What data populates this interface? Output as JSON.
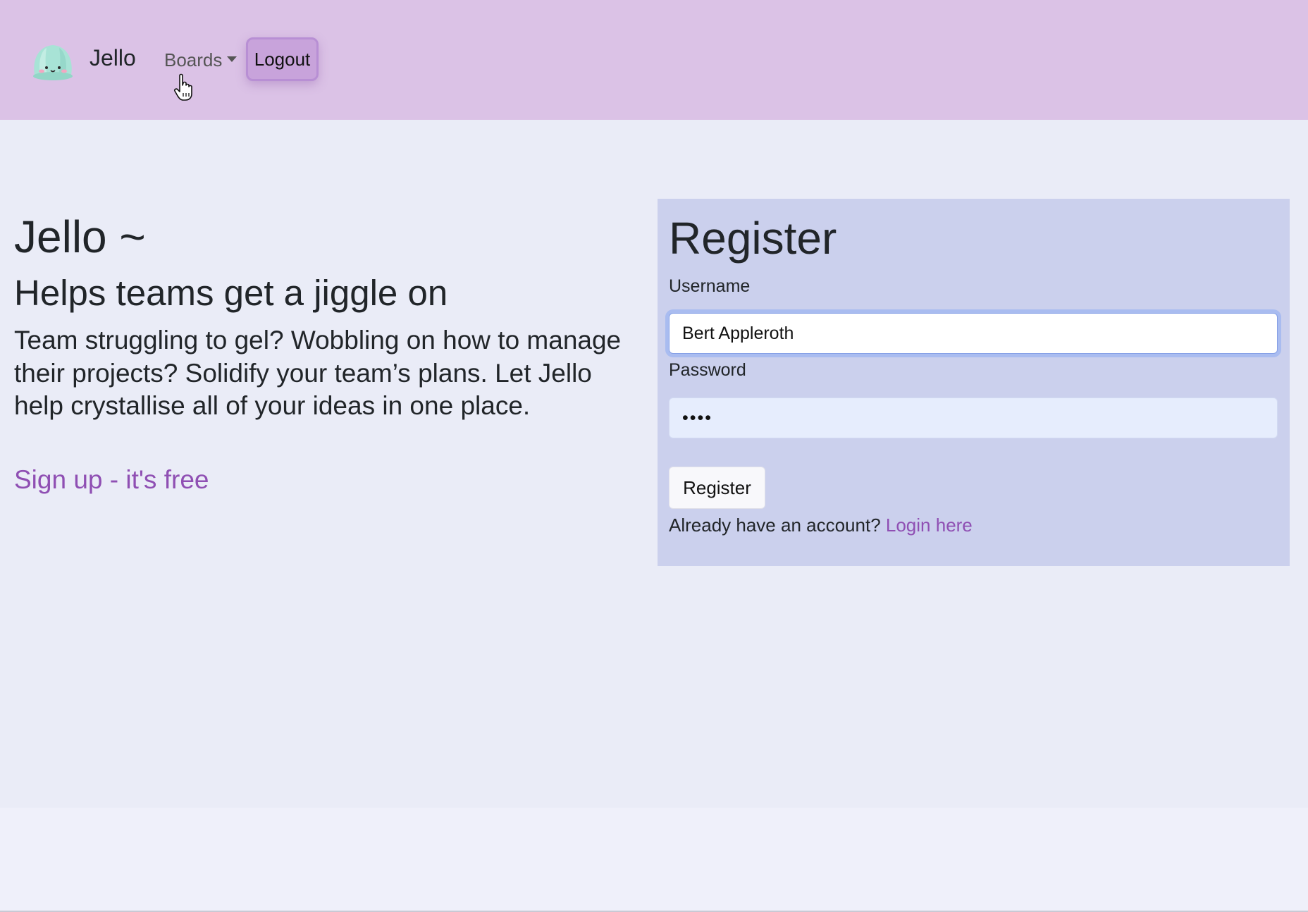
{
  "navbar": {
    "brand": "Jello",
    "boards_label": "Boards",
    "logout_label": "Logout",
    "background": "#dbc2e6"
  },
  "hero": {
    "title": "Jello ~",
    "subtitle": "Helps teams get a jiggle on",
    "description": "Team struggling to gel? Wobbling on how to manage their projects? Solidify your team’s plans. Let Jello help crystallise all of your ideas in one place.",
    "signup_link": "Sign up - it's free"
  },
  "register": {
    "title": "Register",
    "username_label": "Username",
    "username_value": "Bert Appleroth",
    "password_label": "Password",
    "password_value": "••••",
    "button_label": "Register",
    "account_prompt": "Already have an account?",
    "login_link": "Login here"
  },
  "colors": {
    "accent": "#8f4fb3",
    "panel": "#cbd0ed",
    "page": "#eaecf7"
  },
  "icons": {
    "logo": "jello-logo-icon",
    "cursor": "hand-pointer-icon",
    "dropdown": "caret-down-icon"
  }
}
